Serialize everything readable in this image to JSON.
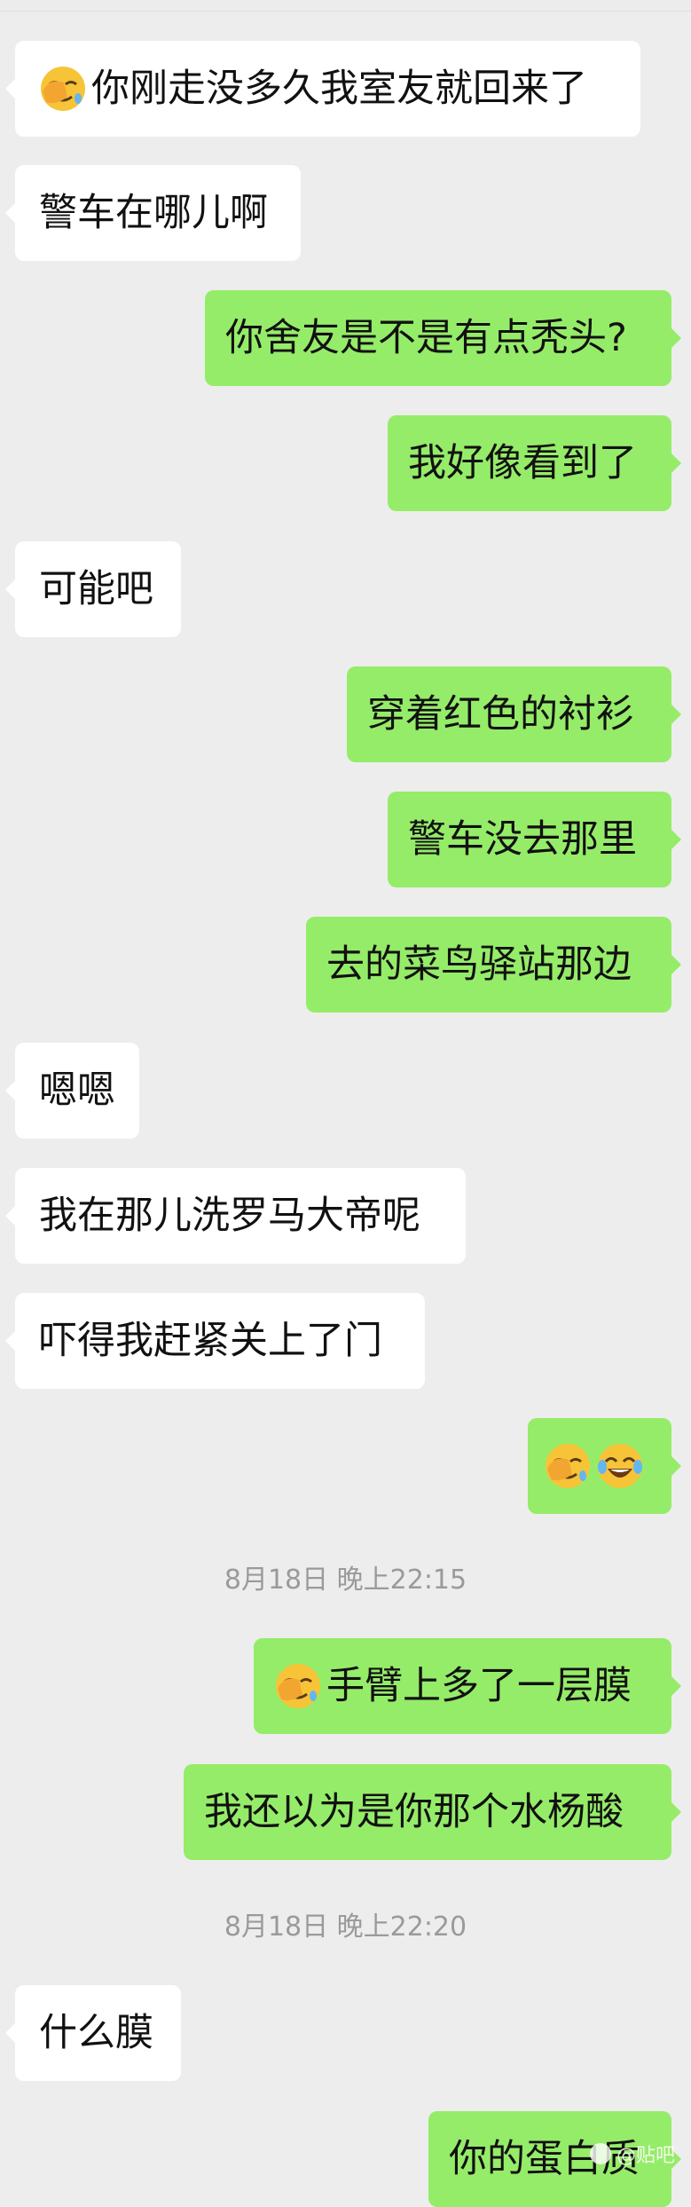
{
  "colors": {
    "background": "#ededed",
    "incoming_bubble": "#ffffff",
    "outgoing_bubble": "#95ec69",
    "timestamp_text": "#9a9a9a"
  },
  "messages": [
    {
      "text": "你刚走没多久我室友就回来了",
      "emoji": "facepalm-icon"
    },
    {
      "text": "警车在哪儿啊"
    },
    {
      "text": "你舍友是不是有点秃头?"
    },
    {
      "text": "我好像看到了"
    },
    {
      "text": "可能吧"
    },
    {
      "text": "穿着红色的衬衫"
    },
    {
      "text": "警车没去那里"
    },
    {
      "text": "去的菜鸟驿站那边"
    },
    {
      "text": "嗯嗯"
    },
    {
      "text": "我在那儿洗罗马大帝呢"
    },
    {
      "text": "吓得我赶紧关上了门"
    },
    {
      "emoji": [
        "facepalm-icon",
        "tears-of-joy-icon"
      ]
    },
    {
      "text": "手臂上多了一层膜",
      "emoji": "facepalm-icon"
    },
    {
      "text": "我还以为是你那个水杨酸"
    },
    {
      "text": "什么膜"
    },
    {
      "text": "你的蛋白质"
    }
  ],
  "timestamps": [
    "8月18日 晚上22:15",
    "8月18日 晚上22:20"
  ],
  "watermark": "@贴吧"
}
